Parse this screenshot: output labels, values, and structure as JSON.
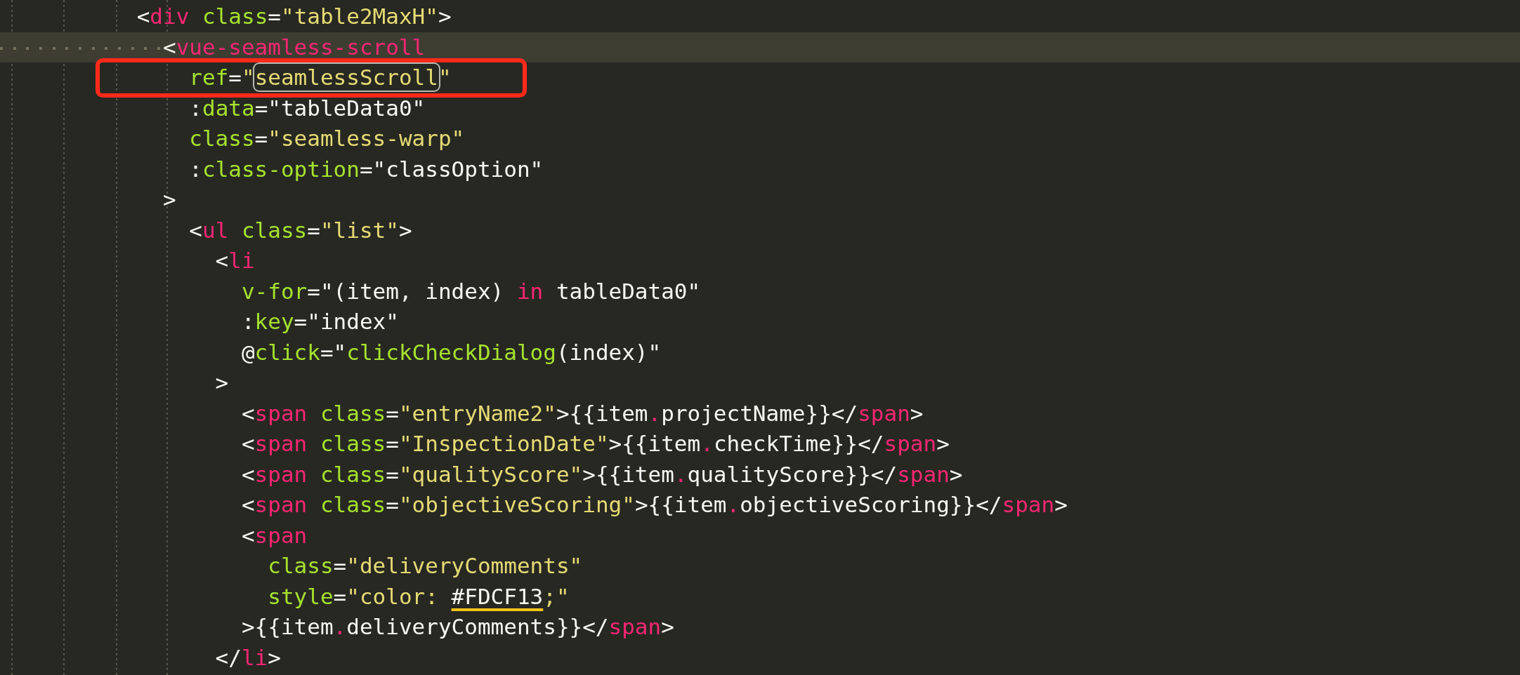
{
  "lines": [
    {
      "current": false,
      "annotated": false,
      "tokens": [
        {
          "kind": "p",
          "text": "          <"
        },
        {
          "kind": "tag",
          "text": "div"
        },
        {
          "kind": "attr",
          "text": " class"
        },
        {
          "kind": "p",
          "text": "="
        },
        {
          "kind": "str",
          "text": "\"table2MaxH\""
        },
        {
          "kind": "p",
          "text": ">"
        }
      ]
    },
    {
      "current": true,
      "annotated": false,
      "tokens": [
        {
          "kind": "p",
          "text": "            <"
        },
        {
          "kind": "tag",
          "text": "vue-seamless-scroll"
        }
      ]
    },
    {
      "current": false,
      "annotated": true,
      "tokens": [
        {
          "kind": "attr",
          "text": "              ref"
        },
        {
          "kind": "p",
          "text": "="
        },
        {
          "kind": "str",
          "text": "\""
        },
        {
          "kind": "found",
          "text": "seamlessScroll"
        },
        {
          "kind": "str",
          "text": "\""
        }
      ]
    },
    {
      "current": false,
      "annotated": false,
      "tokens": [
        {
          "kind": "p",
          "text": "              :"
        },
        {
          "kind": "attr",
          "text": "data"
        },
        {
          "kind": "p",
          "text": "=\"tableData0\""
        }
      ]
    },
    {
      "current": false,
      "annotated": false,
      "tokens": [
        {
          "kind": "attr",
          "text": "              class"
        },
        {
          "kind": "p",
          "text": "="
        },
        {
          "kind": "str",
          "text": "\"seamless-warp\""
        }
      ]
    },
    {
      "current": false,
      "annotated": false,
      "tokens": [
        {
          "kind": "p",
          "text": "              :"
        },
        {
          "kind": "attr",
          "text": "class-option"
        },
        {
          "kind": "p",
          "text": "=\"classOption\""
        }
      ]
    },
    {
      "current": false,
      "annotated": false,
      "tokens": [
        {
          "kind": "p",
          "text": "            >"
        }
      ]
    },
    {
      "current": false,
      "annotated": false,
      "tokens": [
        {
          "kind": "p",
          "text": "              <"
        },
        {
          "kind": "tag",
          "text": "ul"
        },
        {
          "kind": "attr",
          "text": " class"
        },
        {
          "kind": "p",
          "text": "="
        },
        {
          "kind": "str",
          "text": "\"list\""
        },
        {
          "kind": "p",
          "text": ">"
        }
      ]
    },
    {
      "current": false,
      "annotated": false,
      "tokens": [
        {
          "kind": "p",
          "text": "                <"
        },
        {
          "kind": "tag",
          "text": "li"
        }
      ]
    },
    {
      "current": false,
      "annotated": false,
      "tokens": [
        {
          "kind": "attr",
          "text": "                  v-for"
        },
        {
          "kind": "p",
          "text": "=\"(item, index) "
        },
        {
          "kind": "tag",
          "text": "in"
        },
        {
          "kind": "p",
          "text": " tableData0\""
        }
      ]
    },
    {
      "current": false,
      "annotated": false,
      "tokens": [
        {
          "kind": "p",
          "text": "                  :"
        },
        {
          "kind": "attr",
          "text": "key"
        },
        {
          "kind": "p",
          "text": "=\"index\""
        }
      ]
    },
    {
      "current": false,
      "annotated": false,
      "tokens": [
        {
          "kind": "p",
          "text": "                  @"
        },
        {
          "kind": "attr",
          "text": "click"
        },
        {
          "kind": "p",
          "text": "=\""
        },
        {
          "kind": "attr",
          "text": "clickCheckDialog"
        },
        {
          "kind": "p",
          "text": "(index)\""
        }
      ]
    },
    {
      "current": false,
      "annotated": false,
      "tokens": [
        {
          "kind": "p",
          "text": "                >"
        }
      ]
    },
    {
      "current": false,
      "annotated": false,
      "tokens": [
        {
          "kind": "p",
          "text": "                  <"
        },
        {
          "kind": "tag",
          "text": "span"
        },
        {
          "kind": "attr",
          "text": " class"
        },
        {
          "kind": "p",
          "text": "="
        },
        {
          "kind": "str",
          "text": "\"entryName2\""
        },
        {
          "kind": "p",
          "text": ">{{item"
        },
        {
          "kind": "tag",
          "text": "."
        },
        {
          "kind": "p",
          "text": "projectName}}</"
        },
        {
          "kind": "tag",
          "text": "span"
        },
        {
          "kind": "p",
          "text": ">"
        }
      ]
    },
    {
      "current": false,
      "annotated": false,
      "tokens": [
        {
          "kind": "p",
          "text": "                  <"
        },
        {
          "kind": "tag",
          "text": "span"
        },
        {
          "kind": "attr",
          "text": " class"
        },
        {
          "kind": "p",
          "text": "="
        },
        {
          "kind": "str",
          "text": "\"InspectionDate\""
        },
        {
          "kind": "p",
          "text": ">{{item"
        },
        {
          "kind": "tag",
          "text": "."
        },
        {
          "kind": "p",
          "text": "checkTime}}</"
        },
        {
          "kind": "tag",
          "text": "span"
        },
        {
          "kind": "p",
          "text": ">"
        }
      ]
    },
    {
      "current": false,
      "annotated": false,
      "tokens": [
        {
          "kind": "p",
          "text": "                  <"
        },
        {
          "kind": "tag",
          "text": "span"
        },
        {
          "kind": "attr",
          "text": " class"
        },
        {
          "kind": "p",
          "text": "="
        },
        {
          "kind": "str",
          "text": "\"qualityScore\""
        },
        {
          "kind": "p",
          "text": ">{{item"
        },
        {
          "kind": "tag",
          "text": "."
        },
        {
          "kind": "p",
          "text": "qualityScore}}</"
        },
        {
          "kind": "tag",
          "text": "span"
        },
        {
          "kind": "p",
          "text": ">"
        }
      ]
    },
    {
      "current": false,
      "annotated": false,
      "tokens": [
        {
          "kind": "p",
          "text": "                  <"
        },
        {
          "kind": "tag",
          "text": "span"
        },
        {
          "kind": "attr",
          "text": " class"
        },
        {
          "kind": "p",
          "text": "="
        },
        {
          "kind": "str",
          "text": "\"objectiveScoring\""
        },
        {
          "kind": "p",
          "text": ">{{item"
        },
        {
          "kind": "tag",
          "text": "."
        },
        {
          "kind": "p",
          "text": "objectiveScoring}}</"
        },
        {
          "kind": "tag",
          "text": "span"
        },
        {
          "kind": "p",
          "text": ">"
        }
      ]
    },
    {
      "current": false,
      "annotated": false,
      "tokens": [
        {
          "kind": "p",
          "text": "                  <"
        },
        {
          "kind": "tag",
          "text": "span"
        }
      ]
    },
    {
      "current": false,
      "annotated": false,
      "tokens": [
        {
          "kind": "attr",
          "text": "                    class"
        },
        {
          "kind": "p",
          "text": "="
        },
        {
          "kind": "str",
          "text": "\"deliveryComments\""
        }
      ]
    },
    {
      "current": false,
      "annotated": false,
      "tokens": [
        {
          "kind": "attr",
          "text": "                    style"
        },
        {
          "kind": "p",
          "text": "="
        },
        {
          "kind": "str",
          "text": "\"color: "
        },
        {
          "kind": "swatch",
          "text": "#FDCF13"
        },
        {
          "kind": "str",
          "text": ";\""
        }
      ]
    },
    {
      "current": false,
      "annotated": false,
      "tokens": [
        {
          "kind": "p",
          "text": "                  >{{item"
        },
        {
          "kind": "tag",
          "text": "."
        },
        {
          "kind": "p",
          "text": "deliveryComments}}</"
        },
        {
          "kind": "tag",
          "text": "span"
        },
        {
          "kind": "p",
          "text": ">"
        }
      ]
    },
    {
      "current": false,
      "annotated": false,
      "tokens": [
        {
          "kind": "p",
          "text": "                </"
        },
        {
          "kind": "tag",
          "text": "li"
        },
        {
          "kind": "p",
          "text": ">"
        }
      ]
    }
  ]
}
